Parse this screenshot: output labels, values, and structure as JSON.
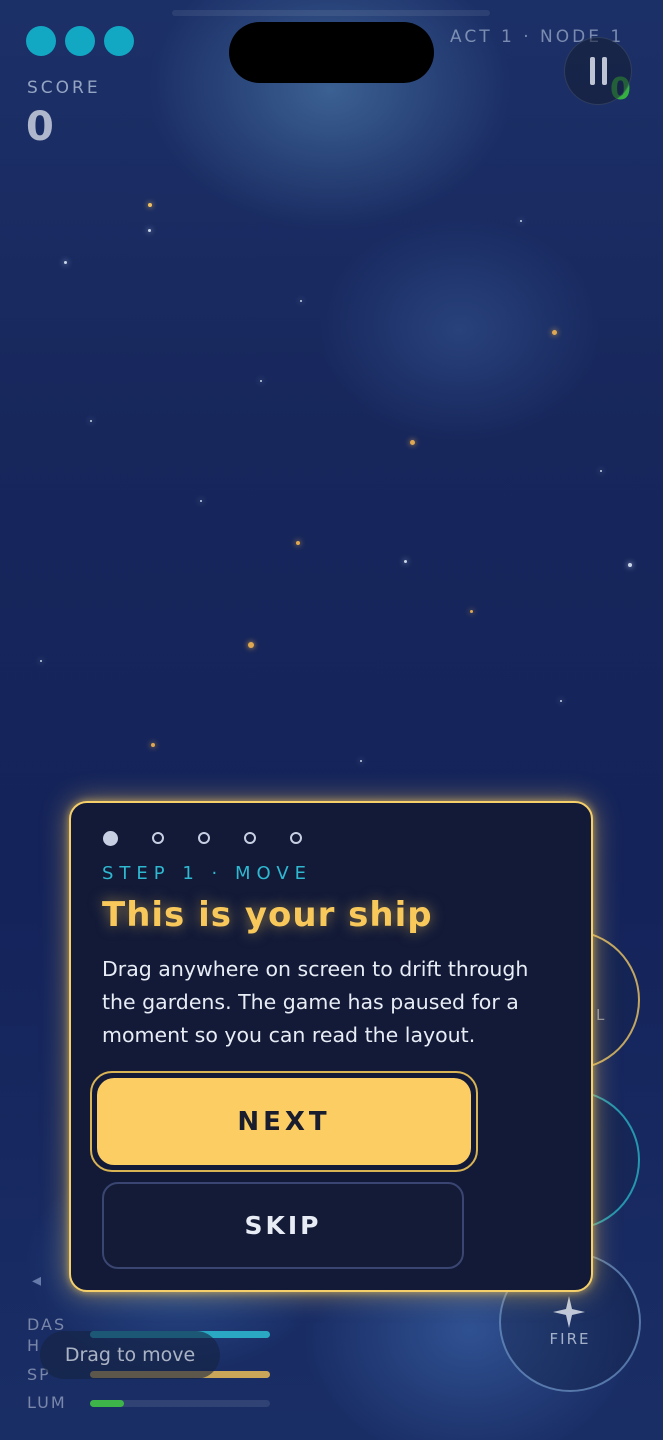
{
  "hud": {
    "lives": 3,
    "score_label": "SCORE",
    "score_value": "0",
    "act_label": "ACT 1 · NODE 1",
    "pause_icon": "pause-icon",
    "counter_value": "0",
    "counter_color": "#35b040"
  },
  "controls": {
    "fire_label": "FIRE",
    "fire_icon": "sparkle-icon",
    "partial_letter": "L"
  },
  "stats": [
    {
      "label": "DAS",
      "fill": 1.0,
      "color": "#2aa7c2"
    },
    {
      "label": "H",
      "fill": 0,
      "color": "#2aa7c2"
    },
    {
      "label": "SP",
      "fill": 1.0,
      "color": "#c9a658"
    },
    {
      "label": "LUM",
      "fill": 0.19,
      "color": "#3db548"
    }
  ],
  "hint": "Drag to move",
  "tutorial": {
    "total_steps": 5,
    "current_step": 1,
    "step_label": "STEP 1 · MOVE",
    "title": "This is your ship",
    "body": "Drag anywhere on screen to drift through the gardens. The game has paused for a moment so you can read the layout.",
    "next_label": "NEXT",
    "skip_label": "SKIP"
  },
  "colors": {
    "accent_gold": "#f8c95a",
    "accent_cyan": "#2fb8d0",
    "life_color": "#12a8c4",
    "dialog_bg": "#121a38"
  }
}
